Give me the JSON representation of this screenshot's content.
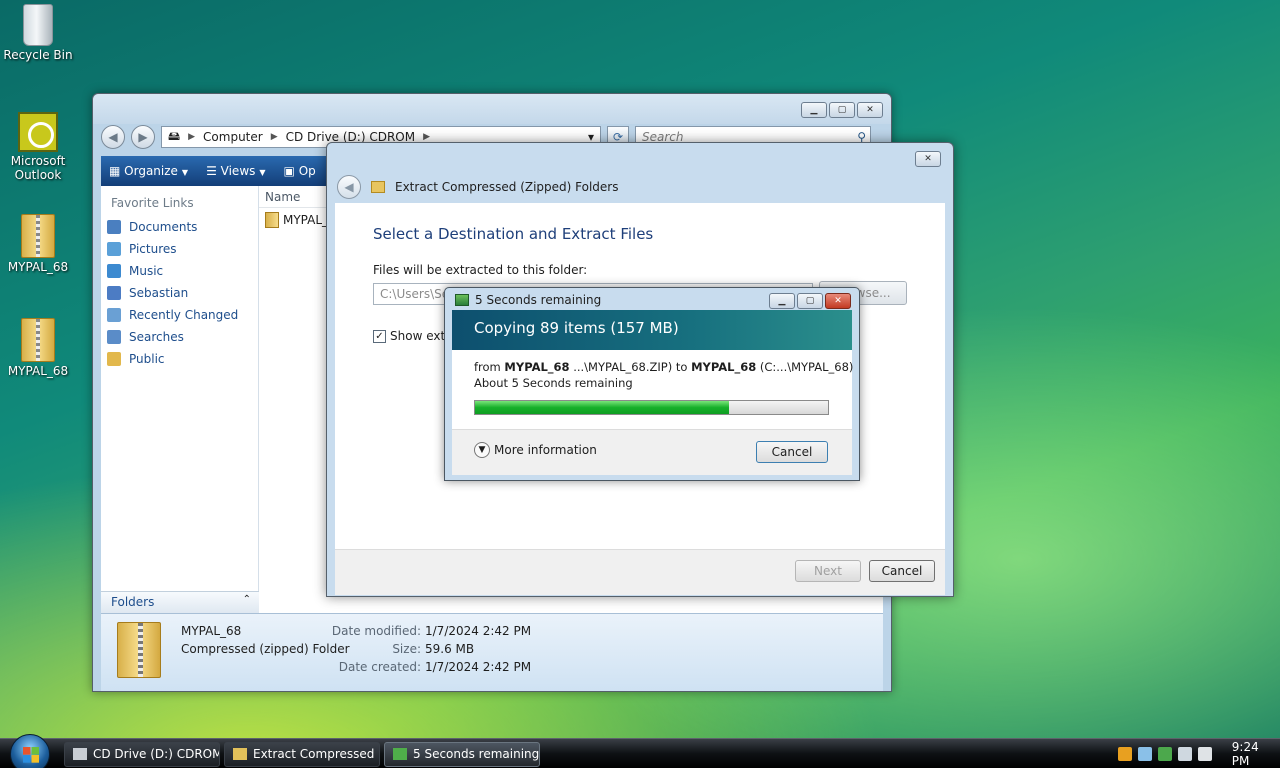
{
  "desktop": {
    "icons": [
      {
        "label": "Recycle Bin"
      },
      {
        "label": "Microsoft Outlook"
      },
      {
        "label": "MYPAL_68"
      },
      {
        "label": "MYPAL_68"
      }
    ]
  },
  "explorer": {
    "address": {
      "crumbs": [
        "Computer",
        "CD Drive (D:) CDROM"
      ]
    },
    "search_placeholder": "Search",
    "toolbar": {
      "organize": "Organize",
      "views": "Views",
      "open": "Op"
    },
    "favorites_title": "Favorite Links",
    "favorites": [
      {
        "label": "Documents",
        "color": "#4a7fc0"
      },
      {
        "label": "Pictures",
        "color": "#5aa0d8"
      },
      {
        "label": "Music",
        "color": "#3c8ad0"
      },
      {
        "label": "Sebastian",
        "color": "#4c7cc4"
      },
      {
        "label": "Recently Changed",
        "color": "#6aa0d4"
      },
      {
        "label": "Searches",
        "color": "#5a8cc8"
      },
      {
        "label": "Public",
        "color": "#e2b84c"
      }
    ],
    "folders_label": "Folders",
    "column_name": "Name",
    "file_item": "MYPAL_",
    "details": {
      "name": "MYPAL_68",
      "type": "Compressed (zipped) Folder",
      "date_modified_label": "Date modified:",
      "date_modified": "1/7/2024 2:42 PM",
      "size_label": "Size:",
      "size": "59.6 MB",
      "date_created_label": "Date created:",
      "date_created": "1/7/2024 2:42 PM"
    }
  },
  "wizard": {
    "title": "Extract Compressed (Zipped) Folders",
    "heading": "Select a Destination and Extract Files",
    "dest_label": "Files will be extracted to this folder:",
    "dest_value": "C:\\Users\\Seb",
    "browse": "Browse...",
    "show_checkbox": "Show extra",
    "next": "Next",
    "cancel": "Cancel"
  },
  "copy_dialog": {
    "title": "5 Seconds remaining",
    "banner": "Copying 89 items (157 MB)",
    "from_word": "from",
    "from_name": "MYPAL_68",
    "from_path": "...\\MYPAL_68.ZIP)",
    "to_word": "to",
    "to_name": "MYPAL_68",
    "to_path": "(C:...\\MYPAL_68)",
    "remaining": "About 5 Seconds remaining",
    "progress": 0.72,
    "more_info": "More information",
    "cancel": "Cancel"
  },
  "taskbar": {
    "buttons": [
      {
        "label": "CD Drive (D:) CDROM"
      },
      {
        "label": "Extract Compressed ..."
      },
      {
        "label": "5 Seconds remaining"
      }
    ],
    "clock": "9:24 PM"
  }
}
